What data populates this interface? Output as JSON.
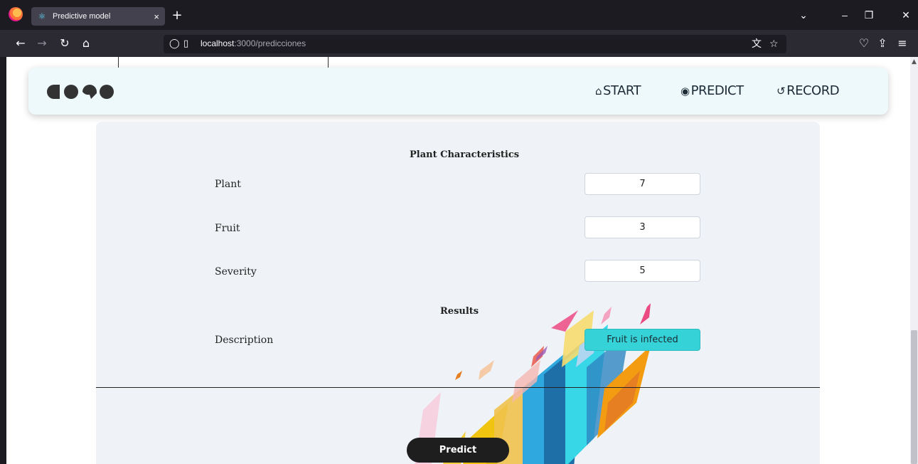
{
  "browser": {
    "tab_title": "Predictive model",
    "tab_close": "×",
    "new_tab": "+",
    "url_host": "localhost",
    "url_path": ":3000/predicciones"
  },
  "app": {
    "nav": {
      "start": "START",
      "predict": "PREDICT",
      "record": "RECORD"
    },
    "form": {
      "title": "Plant Characteristics",
      "fields": [
        {
          "label": "Plant",
          "value": "7"
        },
        {
          "label": "Fruit",
          "value": "3"
        },
        {
          "label": "Severity",
          "value": "5"
        }
      ]
    },
    "results": {
      "title": "Results",
      "description_label": "Description",
      "description_value": "Fruit is infected"
    },
    "predict_button": "Predict"
  },
  "colors": {
    "header_bg": "#edf9fb",
    "card_bg": "#eff3f7",
    "result_bg": "#35d3d8",
    "button_bg": "#1e1e1e"
  }
}
